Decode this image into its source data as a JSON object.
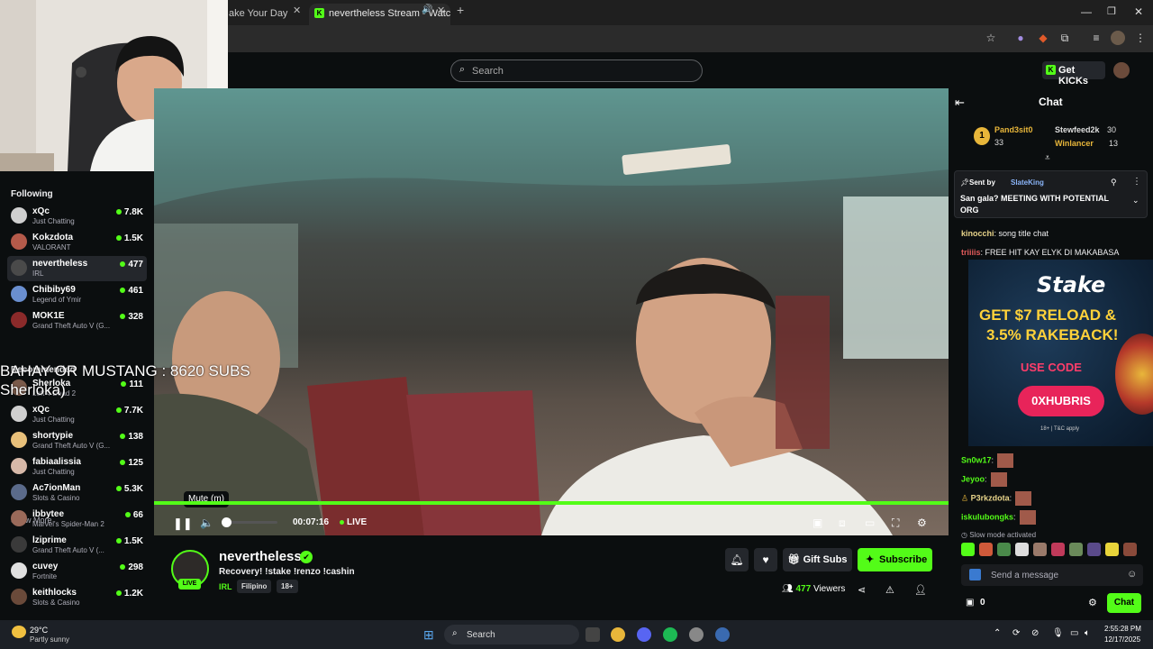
{
  "browser": {
    "tabs": [
      {
        "label": "ake Your Day"
      },
      {
        "label": "nevertheless Stream - Watc"
      }
    ]
  },
  "header": {
    "search_placeholder": "Search",
    "get_kicks_label": "Get KICKs"
  },
  "sidebar": {
    "following_label": "Following",
    "following": [
      {
        "name": "xQc",
        "category": "Just Chatting",
        "viewers": "7.8K",
        "color": "#cfcfcf"
      },
      {
        "name": "Kokzdota",
        "category": "VALORANT",
        "viewers": "1.5K",
        "color": "#b45a4a"
      },
      {
        "name": "nevertheless",
        "category": "IRL",
        "viewers": "477",
        "color": "#4a4a4a"
      },
      {
        "name": "Chibiby69",
        "category": "Legend of Ymir",
        "viewers": "461",
        "color": "#6a8fd0"
      },
      {
        "name": "MOK1E",
        "category": "Grand Theft Auto V (G...",
        "viewers": "328",
        "color": "#8b2a2a"
      }
    ],
    "show_more_label": "Show More",
    "recommended_label": "Recommended",
    "recommended": [
      {
        "name": "Sherloka",
        "category": "Left 4 Dead 2",
        "viewers": "111",
        "color": "#7a5a4a"
      },
      {
        "name": "xQc",
        "category": "Just Chatting",
        "viewers": "7.7K",
        "color": "#cfcfcf"
      },
      {
        "name": "shortypie",
        "category": "Grand Theft Auto V (G...",
        "viewers": "138",
        "color": "#e8c07a"
      },
      {
        "name": "fabiaalissia",
        "category": "Just Chatting",
        "viewers": "125",
        "color": "#d6b8a8"
      },
      {
        "name": "Ac7ionMan",
        "category": "Slots & Casino",
        "viewers": "5.3K",
        "color": "#5a6a8a"
      },
      {
        "name": "ibbytee",
        "category": "Marvel's Spider-Man 2",
        "viewers": "66",
        "color": "#9a6a5a"
      },
      {
        "name": "lziprime",
        "category": "Grand Theft Auto V (...",
        "viewers": "1.5K",
        "color": "#3a3a3a"
      },
      {
        "name": "cuvey",
        "category": "Fortnite",
        "viewers": "298",
        "color": "#e0e0e0"
      },
      {
        "name": "keithlocks",
        "category": "Slots & Casino",
        "viewers": "1.2K",
        "color": "#6a4a3a"
      }
    ]
  },
  "overlay_caption": {
    "line1": "BAHAY OR MUSTANG : 8620 SUBS",
    "line2": "Sherloka)"
  },
  "player": {
    "tooltip": "Mute (m)",
    "time": "00:07:16",
    "live_label": "LIVE",
    "progress_fraction": 1.0,
    "volume_fraction": 0.05
  },
  "stream": {
    "streamer": "nevertheless",
    "live_badge": "LIVE",
    "title": "Recovery! !stake !renzo !cashin",
    "category": "IRL",
    "tags": [
      "Filipino",
      "18+"
    ],
    "gift_label": "Gift Subs",
    "subscribe_label": "Subscribe",
    "viewers_count": "477",
    "viewers_label": "Viewers"
  },
  "chat": {
    "title": "Chat",
    "leaderboard": [
      {
        "rank": "1",
        "name": "Pand3sit0",
        "count": "33"
      },
      {
        "name": "Stewfeed2k",
        "count": "30"
      },
      {
        "name": "Winlancer",
        "count": "13"
      }
    ],
    "pinned": {
      "sent_by_label": "Sent by",
      "sender": "SlateKing",
      "text": "San gala? MEETING WITH POTENTIAL ORG"
    },
    "messages": [
      {
        "user": "kinocchi",
        "text": ": song title chat",
        "color": "#e8d48a"
      },
      {
        "user": "triiiis",
        "text": ": FREE HIT KAY ELYK DI MAKABASA",
        "color": "#e05a5a"
      },
      {
        "user": "Sn0w17",
        "text": ":",
        "color": "#53fc18"
      },
      {
        "user": "Jeyoo",
        "text": ":",
        "color": "#53fc18"
      },
      {
        "user": "P3rkzdota",
        "text": ":",
        "color": "#e8d48a"
      },
      {
        "user": "iskulubongks",
        "text": ":",
        "color": "#53fc18"
      }
    ],
    "ad": {
      "brand": "Stake",
      "headline1": "GET $7 RELOAD &",
      "headline2": "3.5% RAKEBACK!",
      "use_code": "USE CODE",
      "code": "0XHUBRIS",
      "fine": "18+ | T&C apply"
    },
    "slow_mode": "Slow mode activated",
    "input_placeholder": "Send a message",
    "points": "0",
    "chat_button": "Chat"
  },
  "taskbar": {
    "weather_temp": "29°C",
    "weather_desc": "Partly sunny",
    "search_label": "Search",
    "time": "2:55:28 PM",
    "date": "12/17/2025"
  },
  "colors": {
    "accent": "#53fc18",
    "bg": "#0b0e0f",
    "panel": "#24272c"
  }
}
